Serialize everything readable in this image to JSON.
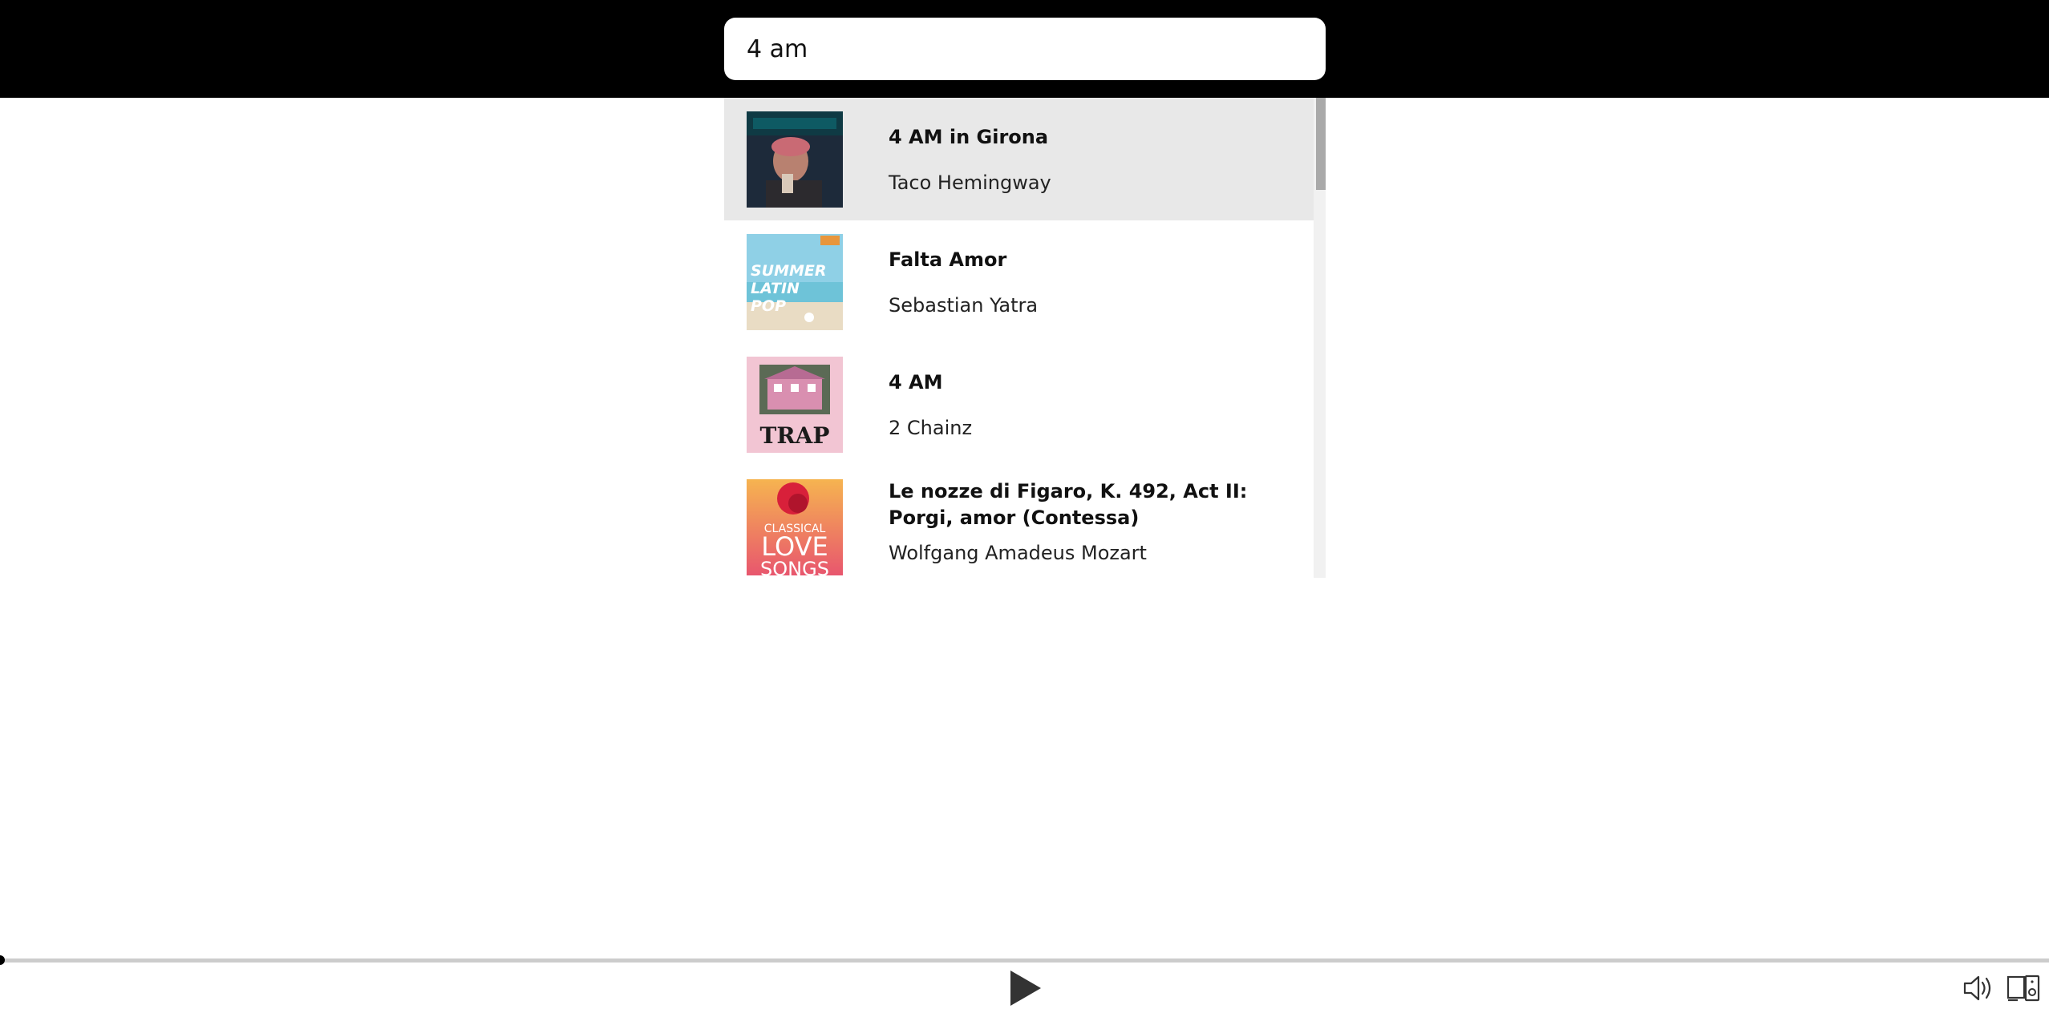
{
  "search": {
    "query": "4 am"
  },
  "results": [
    {
      "title": "4 AM in Girona",
      "artist": "Taco Hemingway",
      "art_icon": "album-art-taco-hemingway"
    },
    {
      "title": "Falta Amor",
      "artist": "Sebastian Yatra",
      "art_icon": "album-art-summer-latin-pop",
      "art_text": [
        "SUMMER",
        "LATIN",
        "POP"
      ]
    },
    {
      "title": "4 AM",
      "artist": "2 Chainz",
      "art_icon": "album-art-trap",
      "art_text": [
        "TRAP"
      ]
    },
    {
      "title": "Le nozze di Figaro, K. 492, Act II: Porgi, amor (Contessa)",
      "artist": "Wolfgang Amadeus Mozart",
      "art_icon": "album-art-classical-love-songs",
      "art_text": [
        "CLASSICAL",
        "LOVE",
        "SONGS"
      ]
    }
  ],
  "player": {
    "progress": 0,
    "icons": [
      "play-icon",
      "volume-icon",
      "devices-icon"
    ]
  },
  "colors": {
    "topbar": "#000000",
    "active_row": "#e8e8e8",
    "scroll_track": "#f1f1f1",
    "scroll_thumb": "#a9a9a9",
    "progress_track": "#cccccc"
  }
}
